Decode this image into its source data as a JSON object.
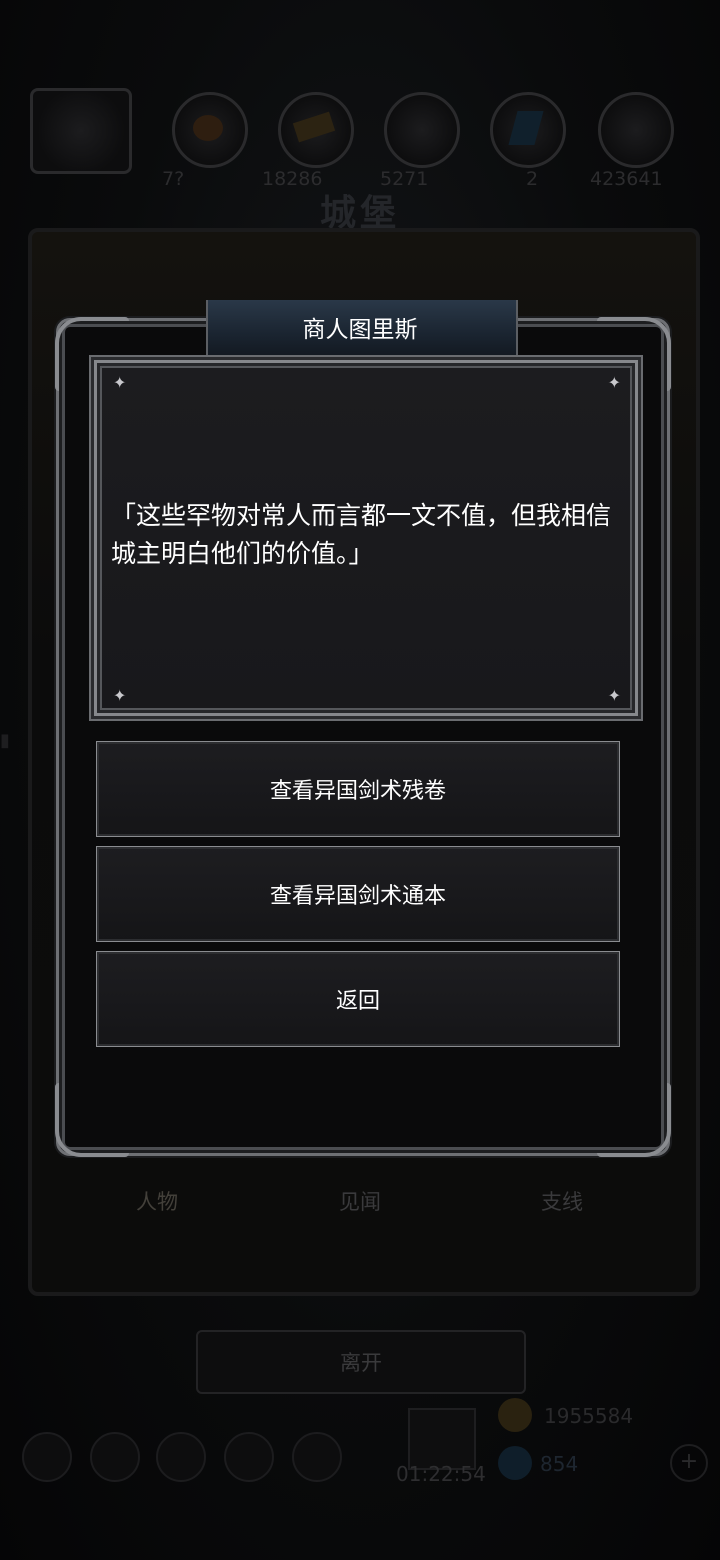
{
  "background": {
    "resources": [
      "7?",
      "18286",
      "5271",
      "2",
      "423641"
    ],
    "castle_title": "城堡",
    "tabs": [
      "人物",
      "见闻",
      "支线"
    ],
    "leave_label": "离开",
    "timer": "01:22:54",
    "gold": "1955584",
    "gems": "854"
  },
  "dialog": {
    "title": "商人图里斯",
    "speech": "「这些罕物对常人而言都一文不值，但我相信城主明白他们的价值。」",
    "options": [
      {
        "label": "查看异国剑术残卷"
      },
      {
        "label": "查看异国剑术通本"
      },
      {
        "label": "返回"
      }
    ]
  }
}
